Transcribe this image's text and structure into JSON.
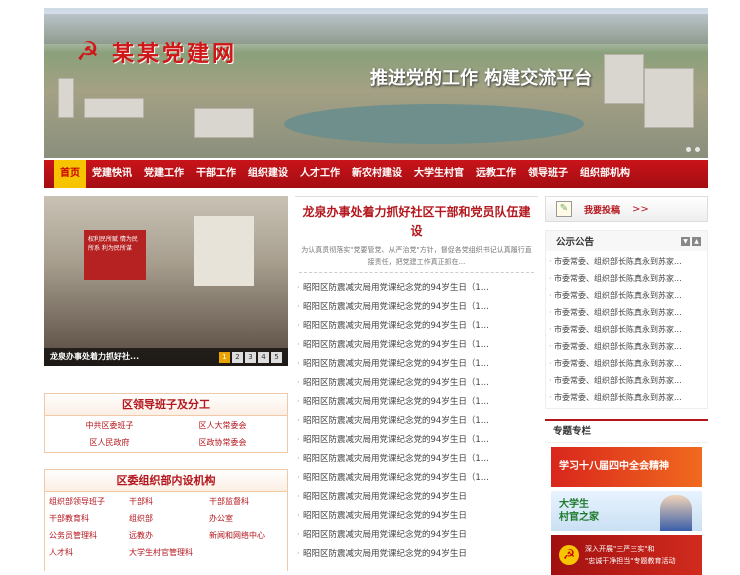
{
  "site": {
    "title": "某某党建网",
    "slogan": "推进党的工作 构建交流平台",
    "logo_icon": "hammer-sickle-icon"
  },
  "nav": [
    "首页",
    "党建快讯",
    "党建工作",
    "干部工作",
    "组织建设",
    "人才工作",
    "新农村建设",
    "大学生村官",
    "远教工作",
    "领导班子",
    "组织部机构"
  ],
  "slide": {
    "caption": "龙泉办事处着力抓好社...",
    "pages": [
      "1",
      "2",
      "3",
      "4",
      "5"
    ],
    "board_text": "权利民所赋 情为民所系 利为民所谋"
  },
  "leaders": {
    "title": "区领导班子及分工",
    "items": [
      "中共区委班子",
      "区人大常委会",
      "区人民政府",
      "区政协常委会"
    ]
  },
  "org": {
    "title": "区委组织部内设机构",
    "items": [
      "组织部领导班子",
      "干部科",
      "干部监督科",
      "干部教育科",
      "组织部",
      "办公室",
      "公务员管理科",
      "远教办",
      "新闻和网络中心",
      "人才科",
      "大学生村官管理科"
    ]
  },
  "headline": {
    "title": "龙泉办事处着力抓好社区干部和党员队伍建设",
    "summary": "为认真贯彻落实\"党要管党、从严治党\"方针，督促各党组织书记认真履行直接责任，把党建工作真正抓在..."
  },
  "news": [
    "昭阳区防震减灾局用党课纪念党的94岁生日（1...",
    "昭阳区防震减灾局用党课纪念党的94岁生日（1...",
    "昭阳区防震减灾局用党课纪念党的94岁生日（1...",
    "昭阳区防震减灾局用党课纪念党的94岁生日（1...",
    "昭阳区防震减灾局用党课纪念党的94岁生日（1...",
    "昭阳区防震减灾局用党课纪念党的94岁生日（1...",
    "昭阳区防震减灾局用党课纪念党的94岁生日（1...",
    "昭阳区防震减灾局用党课纪念党的94岁生日（1...",
    "昭阳区防震减灾局用党课纪念党的94岁生日（1...",
    "昭阳区防震减灾局用党课纪念党的94岁生日（1...",
    "昭阳区防震减灾局用党课纪念党的94岁生日（1...",
    "昭阳区防震减灾局用党课纪念党的94岁生日",
    "昭阳区防震减灾局用党课纪念党的94岁生日",
    "昭阳区防震减灾局用党课纪念党的94岁生日",
    "昭阳区防震减灾局用党课纪念党的94岁生日"
  ],
  "submit": {
    "label": "我要投稿",
    "arrow": ">>",
    "icon": "pen-paper-icon"
  },
  "notice": {
    "title": "公示公告",
    "items": [
      "市委常委、组织部长陈真永到苏家...",
      "市委常委、组织部长陈真永到苏家...",
      "市委常委、组织部长陈真永到苏家...",
      "市委常委、组织部长陈真永到苏家...",
      "市委常委、组织部长陈真永到苏家...",
      "市委常委、组织部长陈真永到苏家...",
      "市委常委、组织部长陈真永到苏家...",
      "市委常委、组织部长陈真永到苏家...",
      "市委常委、组织部长陈真永到苏家..."
    ]
  },
  "special": {
    "title": "专题专栏",
    "p1": "学习十八届四中全会精神",
    "p2a": "大学生",
    "p2b": "村官之家",
    "p3a": "深入开展\"三严三实\"和",
    "p3b": "\"忠诚干净担当\"专题教育活动"
  },
  "colors": {
    "accent": "#b3161c",
    "nav_active": "#f6c400"
  }
}
